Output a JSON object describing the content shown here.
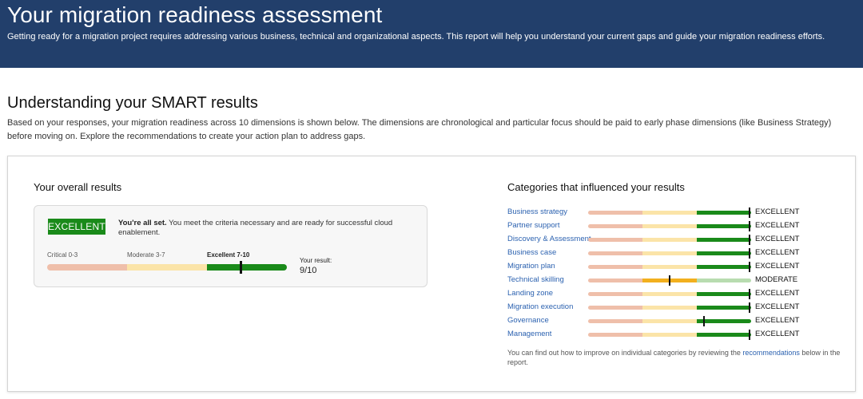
{
  "banner": {
    "title": "Your migration readiness assessment",
    "subtitle": "Getting ready for a migration project requires addressing various business, technical and organizational aspects. This report will help you understand your current gaps and guide your migration readiness efforts."
  },
  "section": {
    "title": "Understanding your SMART results",
    "description": "Based on your responses, your migration readiness across 10 dimensions is shown below. The dimensions are chronological and particular focus should be paid to early phase dimensions (like Business Strategy) before moving on. Explore the recommendations to create your action plan to address gaps."
  },
  "overall": {
    "heading": "Your overall results",
    "badge": "EXCELLENT",
    "message_bold": "You're all set.",
    "message": " You meet the criteria necessary and are ready for successful cloud enablement.",
    "scale": {
      "critical_label": "Critical 0-3",
      "moderate_label": "Moderate 3-7",
      "excellent_label": "Excellent 7-10",
      "result_label": "Your result:",
      "result_value": "9/10",
      "score": 9,
      "max": 10
    },
    "colors": {
      "critical": "#efbfaa",
      "moderate": "#fbe4a8",
      "excellent": "#1a8a1a"
    }
  },
  "categories": {
    "heading": "Categories that influenced your results",
    "items": [
      {
        "name": "Business strategy",
        "rating": "EXCELLENT",
        "level": "excellent",
        "marker": 0.99
      },
      {
        "name": "Partner support",
        "rating": "EXCELLENT",
        "level": "excellent",
        "marker": 0.99
      },
      {
        "name": "Discovery & Assessment",
        "rating": "EXCELLENT",
        "level": "excellent",
        "marker": 0.99
      },
      {
        "name": "Business case",
        "rating": "EXCELLENT",
        "level": "excellent",
        "marker": 0.99
      },
      {
        "name": "Migration plan",
        "rating": "EXCELLENT",
        "level": "excellent",
        "marker": 0.99
      },
      {
        "name": "Technical skilling",
        "rating": "MODERATE",
        "level": "moderate",
        "marker": 0.5
      },
      {
        "name": "Landing zone",
        "rating": "EXCELLENT",
        "level": "excellent",
        "marker": 0.99
      },
      {
        "name": "Migration execution",
        "rating": "EXCELLENT",
        "level": "excellent",
        "marker": 0.99
      },
      {
        "name": "Governance",
        "rating": "EXCELLENT",
        "level": "excellent",
        "marker": 0.71
      },
      {
        "name": "Management",
        "rating": "EXCELLENT",
        "level": "excellent",
        "marker": 0.99
      }
    ],
    "footer_before": "You can find out how to improve on individual categories by reviewing the ",
    "footer_link": "recommendations",
    "footer_after": " below in the report."
  },
  "palette": {
    "critical_light": "#efbfaa",
    "moderate_light": "#fbe4a8",
    "moderate_strong": "#f2b01e",
    "excellent_strong": "#1a8a1a",
    "excellent_light": "#b8dcb0"
  }
}
